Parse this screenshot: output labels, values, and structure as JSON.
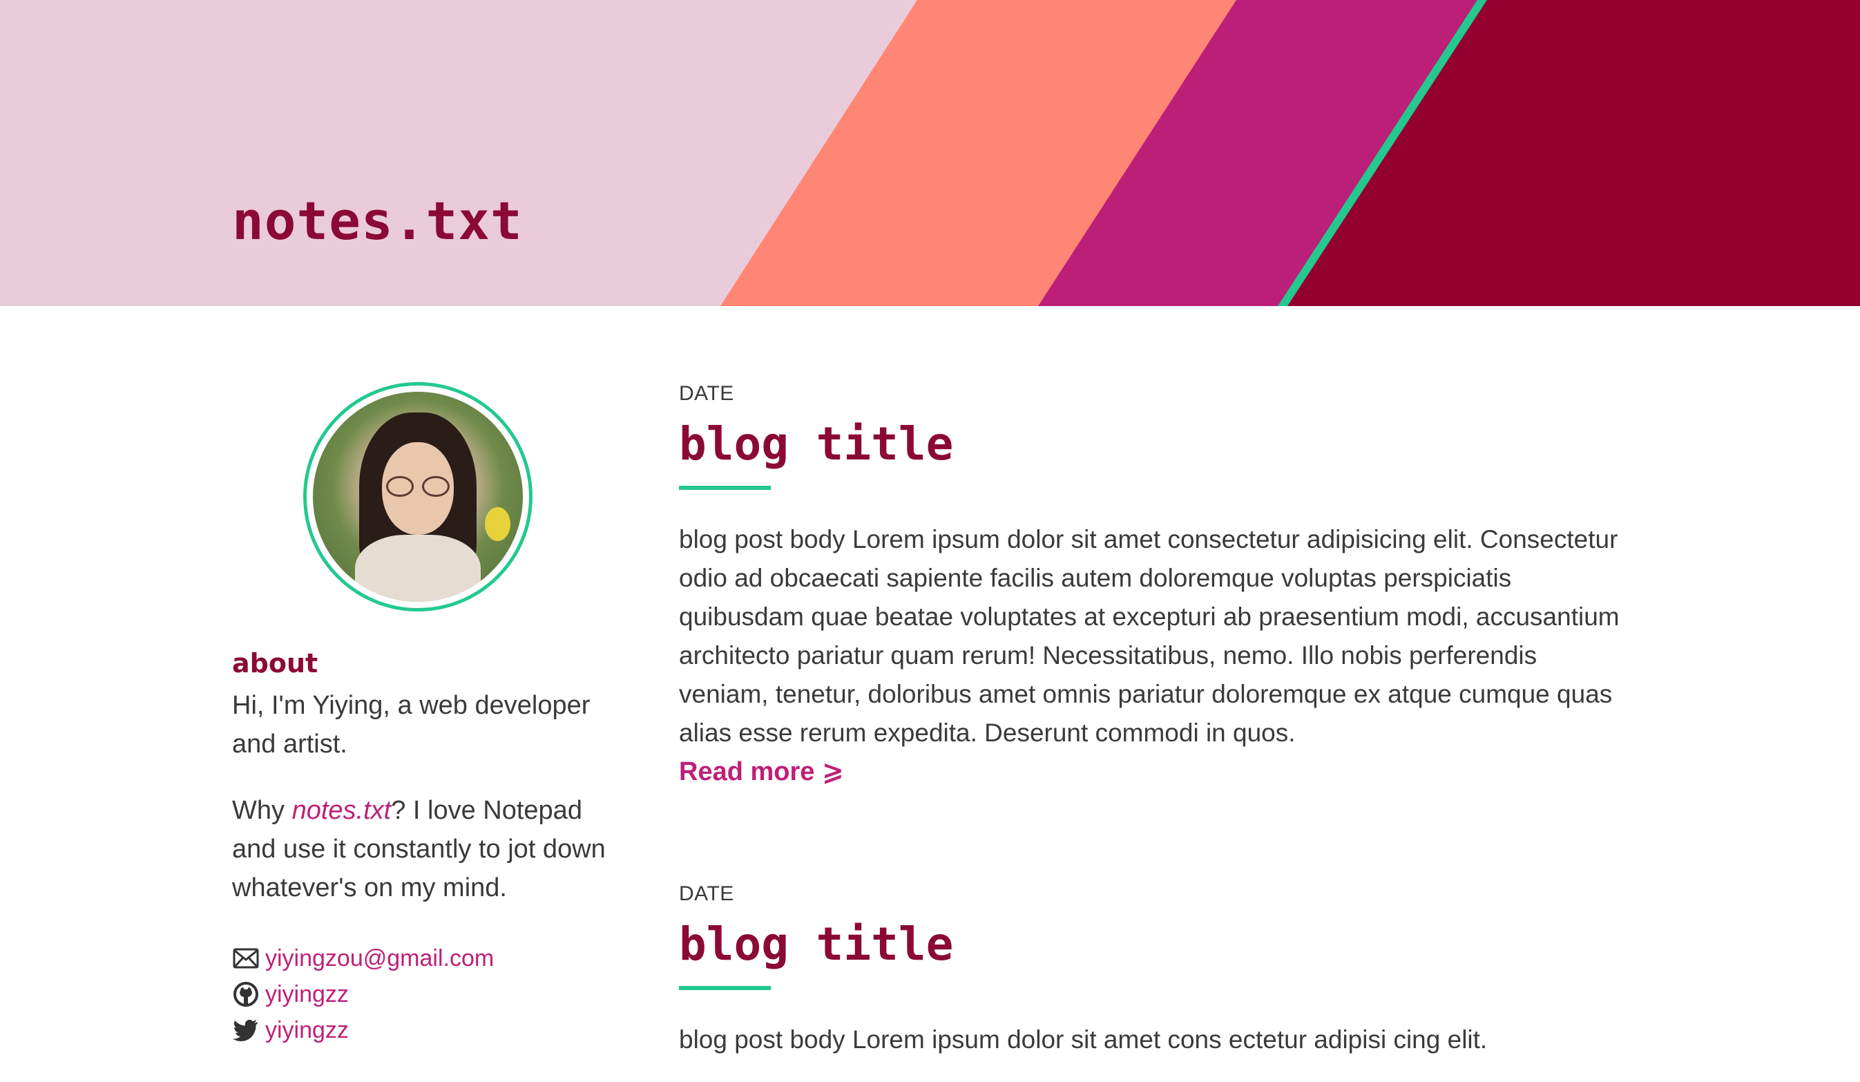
{
  "header": {
    "site_title": "notes.txt",
    "colors": {
      "background": "#eacbd9",
      "stripe_salmon": "#ff8675",
      "stripe_magenta": "#bc1f78",
      "stripe_teal": "#23c98f",
      "stripe_crimson": "#930030"
    }
  },
  "sidebar": {
    "about_heading": "about",
    "about_text": "Hi, I'm Yiying, a web developer and artist.",
    "why_prefix": "Why ",
    "why_accent": "notes.txt",
    "why_suffix": "? I love Notepad and use it constantly to jot down whatever's on my mind.",
    "contacts": [
      {
        "icon": "mail-icon",
        "label": "yiyingzou@gmail.com"
      },
      {
        "icon": "github-icon",
        "label": "yiyingzz"
      },
      {
        "icon": "twitter-icon",
        "label": "yiyingzz"
      }
    ]
  },
  "posts": [
    {
      "date": "DATE",
      "title": "blog title",
      "body": "blog post body Lorem ipsum dolor sit amet consectetur adipisicing elit. Consectetur odio ad obcaecati sapiente facilis autem doloremque voluptas perspiciatis quibusdam quae beatae voluptates at excepturi ab praesentium modi, accusantium architecto pariatur quam rerum! Necessitatibus, nemo. Illo nobis perferendis veniam, tenetur, doloribus amet omnis pariatur doloremque ex atque cumque quas alias esse rerum expedita. Deserunt commodi in quos.",
      "read_more": "Read more ⩾"
    },
    {
      "date": "DATE",
      "title": "blog title",
      "body": "blog post body Lorem ipsum dolor sit amet cons ectetur adipisi cing elit."
    }
  ]
}
